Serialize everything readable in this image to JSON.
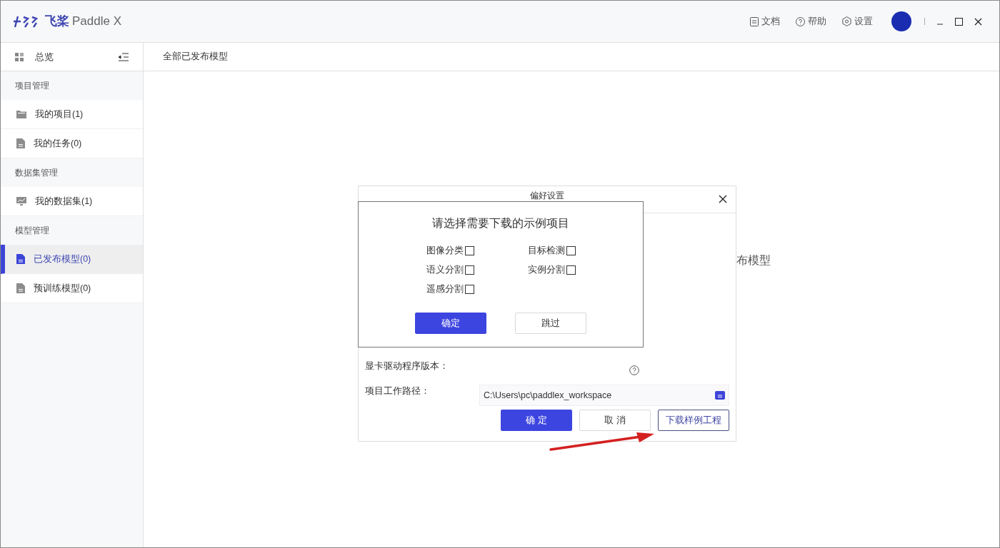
{
  "header": {
    "logo_cn": "飞桨",
    "logo_en": "Paddle X",
    "links": [
      {
        "kind": "doc",
        "label": "文档"
      },
      {
        "kind": "help",
        "label": "帮助"
      },
      {
        "kind": "settings",
        "label": "设置"
      }
    ]
  },
  "sidebar": {
    "overview": "总览",
    "groups": [
      {
        "title": "项目管理",
        "items": [
          {
            "kind": "folder",
            "label": "我的项目(1)",
            "selected": false
          },
          {
            "kind": "file",
            "label": "我的任务(0)",
            "selected": false
          }
        ]
      },
      {
        "title": "数据集管理",
        "items": [
          {
            "kind": "chart",
            "label": "我的数据集(1)",
            "selected": false
          }
        ]
      },
      {
        "title": "模型管理",
        "items": [
          {
            "kind": "file",
            "label": "已发布模型(0)",
            "selected": true
          },
          {
            "kind": "file",
            "label": "预训练模型(0)",
            "selected": false
          }
        ]
      }
    ]
  },
  "content": {
    "breadcrumb": "全部已发布模型",
    "background_text": "布模型"
  },
  "preferences_dialog": {
    "title": "偏好设置",
    "fields": [
      {
        "label": "显卡驱动程序版本："
      },
      {
        "label": "项目工作路径：",
        "value": "C:\\Users\\pc\\paddlex_workspace"
      }
    ],
    "buttons": [
      {
        "kind": "primary",
        "label": "确 定"
      },
      {
        "kind": "default",
        "label": "取 消"
      },
      {
        "kind": "outline",
        "label": "下载样例工程"
      }
    ]
  },
  "sample_dialog": {
    "title": "请选择需要下载的示例项目",
    "options": [
      {
        "label": "图像分类",
        "checked": false
      },
      {
        "label": "目标检测",
        "checked": false
      },
      {
        "label": "语义分割",
        "checked": false
      },
      {
        "label": "实例分割",
        "checked": false
      },
      {
        "label": "遥感分割",
        "checked": false
      }
    ],
    "buttons": [
      {
        "kind": "primary",
        "label": "确定"
      },
      {
        "kind": "default",
        "label": "跳过"
      }
    ]
  }
}
